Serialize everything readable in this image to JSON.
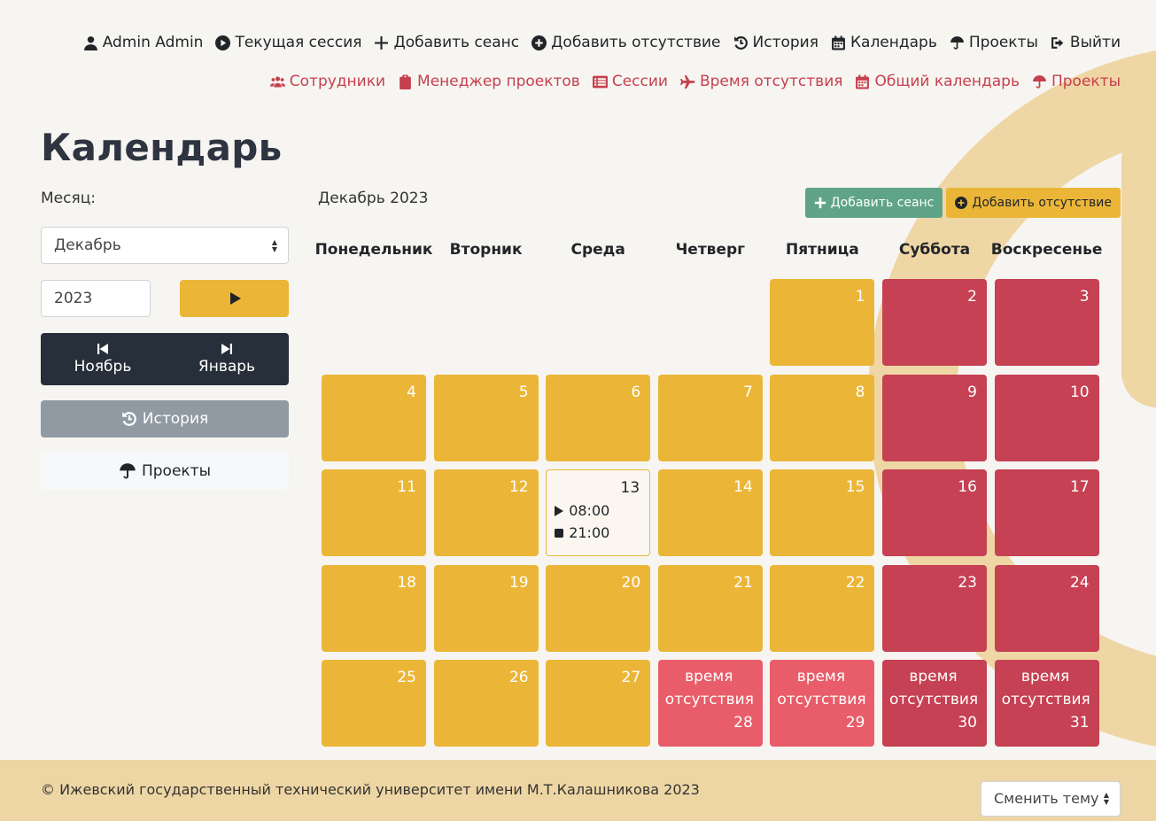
{
  "nav": {
    "user_label": "Admin Admin",
    "current_session": "Текущая сессия",
    "add_session": "Добавить сеанс",
    "add_absence": "Добавить отсутствие",
    "history": "История",
    "calendar": "Календарь",
    "projects": "Проекты",
    "logout": "Выйти"
  },
  "admin_nav": {
    "employees": "Сотрудники",
    "project_manager": "Менеджер проектов",
    "sessions": "Сессии",
    "absence_time": "Время отсутствия",
    "general_calendar": "Общий календарь",
    "projects": "Проекты"
  },
  "page": {
    "title": "Календарь"
  },
  "sidebar": {
    "month_label": "Месяц:",
    "month_value": "Декабрь",
    "year_value": "2023",
    "prev_month": "Ноябрь",
    "next_month": "Январь",
    "history_label": "История",
    "projects_label": "Проекты"
  },
  "calendar": {
    "heading": "Декабрь 2023",
    "add_session_btn": "Добавить сеанс",
    "add_absence_btn": "Добавить отсутствие",
    "weekdays": [
      "Понедельник",
      "Вторник",
      "Среда",
      "Четверг",
      "Пятница",
      "Суббота",
      "Воскресенье"
    ],
    "absence_text": "время отсутствия",
    "session_start": "08:00",
    "session_end": "21:00",
    "days": [
      {
        "n": "1",
        "col": 4,
        "row": 0,
        "type": "work"
      },
      {
        "n": "2",
        "col": 5,
        "row": 0,
        "type": "weekend"
      },
      {
        "n": "3",
        "col": 6,
        "row": 0,
        "type": "weekend"
      },
      {
        "n": "4",
        "col": 0,
        "row": 1,
        "type": "work"
      },
      {
        "n": "5",
        "col": 1,
        "row": 1,
        "type": "work"
      },
      {
        "n": "6",
        "col": 2,
        "row": 1,
        "type": "work"
      },
      {
        "n": "7",
        "col": 3,
        "row": 1,
        "type": "work"
      },
      {
        "n": "8",
        "col": 4,
        "row": 1,
        "type": "work"
      },
      {
        "n": "9",
        "col": 5,
        "row": 1,
        "type": "weekend"
      },
      {
        "n": "10",
        "col": 6,
        "row": 1,
        "type": "weekend"
      },
      {
        "n": "11",
        "col": 0,
        "row": 2,
        "type": "work"
      },
      {
        "n": "12",
        "col": 1,
        "row": 2,
        "type": "work"
      },
      {
        "n": "13",
        "col": 2,
        "row": 2,
        "type": "today"
      },
      {
        "n": "14",
        "col": 3,
        "row": 2,
        "type": "work"
      },
      {
        "n": "15",
        "col": 4,
        "row": 2,
        "type": "work"
      },
      {
        "n": "16",
        "col": 5,
        "row": 2,
        "type": "weekend"
      },
      {
        "n": "17",
        "col": 6,
        "row": 2,
        "type": "weekend"
      },
      {
        "n": "18",
        "col": 0,
        "row": 3,
        "type": "work"
      },
      {
        "n": "19",
        "col": 1,
        "row": 3,
        "type": "work"
      },
      {
        "n": "20",
        "col": 2,
        "row": 3,
        "type": "work"
      },
      {
        "n": "21",
        "col": 3,
        "row": 3,
        "type": "work"
      },
      {
        "n": "22",
        "col": 4,
        "row": 3,
        "type": "work"
      },
      {
        "n": "23",
        "col": 5,
        "row": 3,
        "type": "weekend"
      },
      {
        "n": "24",
        "col": 6,
        "row": 3,
        "type": "weekend"
      },
      {
        "n": "25",
        "col": 0,
        "row": 4,
        "type": "work"
      },
      {
        "n": "26",
        "col": 1,
        "row": 4,
        "type": "work"
      },
      {
        "n": "27",
        "col": 2,
        "row": 4,
        "type": "work"
      },
      {
        "n": "28",
        "col": 3,
        "row": 4,
        "type": "absent"
      },
      {
        "n": "29",
        "col": 4,
        "row": 4,
        "type": "absent"
      },
      {
        "n": "30",
        "col": 5,
        "row": 4,
        "type": "absent-weekend"
      },
      {
        "n": "31",
        "col": 6,
        "row": 4,
        "type": "absent-weekend"
      }
    ]
  },
  "footer": {
    "copyright": "© Ижевский государственный технический университет имени М.Т.Калашникова 2023",
    "theme_select": "Сменить тему"
  },
  "colors": {
    "yellow": "#ebb638",
    "red": "#c54153",
    "light_red": "#e85d69",
    "dark": "#262f3a",
    "footer": "#eed6a4"
  }
}
